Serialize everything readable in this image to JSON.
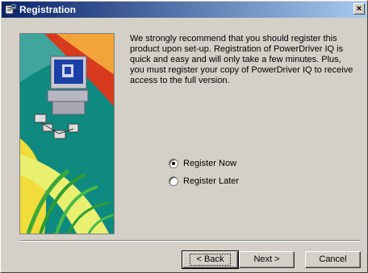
{
  "window": {
    "title": "Registration",
    "close_label": "×"
  },
  "icons": {
    "app": "registration-app-icon",
    "close": "close-icon",
    "illustration": "computer-network-illustration"
  },
  "body": {
    "message": "We strongly recommend that you should register this product upon set-up.  Registration of PowerDriver IQ is quick and easy and will only take a few minutes.  Plus, you must register your copy of PowerDriver IQ to receive access to the full version."
  },
  "options": [
    {
      "label": "Register Now",
      "selected": true
    },
    {
      "label": "Register Later",
      "selected": false
    }
  ],
  "buttons": {
    "back": "< Back",
    "next": "Next >",
    "cancel": "Cancel"
  },
  "colors": {
    "titlebar_start": "#0a246a",
    "titlebar_end": "#a6caf0",
    "dialog_bg": "#d4d0c8",
    "illustration_teal": "#0f8a80"
  }
}
